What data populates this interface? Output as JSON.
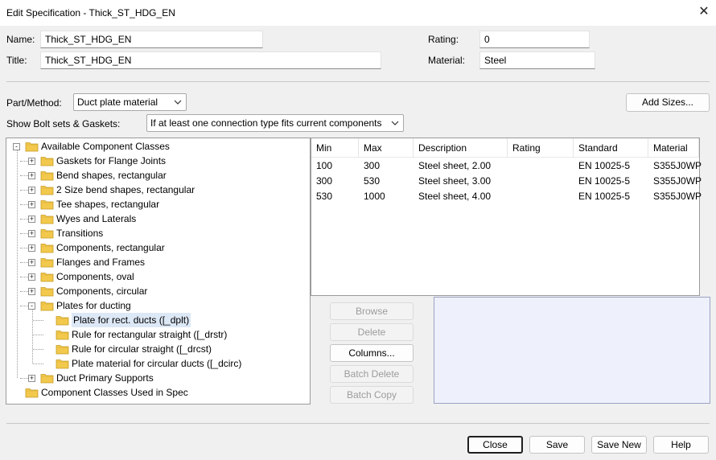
{
  "window": {
    "title": "Edit Specification - Thick_ST_HDG_EN",
    "close_glyph": "✕"
  },
  "form": {
    "name_label": "Name:",
    "name_value": "Thick_ST_HDG_EN",
    "title_label": "Title:",
    "title_value": "Thick_ST_HDG_EN",
    "rating_label": "Rating:",
    "rating_value": "0",
    "material_label": "Material:",
    "material_value": "Steel"
  },
  "part_method": {
    "label": "Part/Method:",
    "value": "Duct plate material"
  },
  "bolt_sets": {
    "label": "Show Bolt sets & Gaskets:",
    "value": "If at least one connection type fits current components"
  },
  "add_sizes_button": "Add Sizes...",
  "tree": {
    "root": "Available Component Classes",
    "items": [
      "Gaskets for Flange Joints",
      "Bend shapes, rectangular",
      "2 Size bend shapes, rectangular",
      "Tee shapes, rectangular",
      "Wyes and Laterals",
      "Transitions",
      "Components, rectangular",
      "Flanges and Frames",
      "Components, oval",
      "Components, circular",
      "Plates for ducting"
    ],
    "children": [
      "Plate for rect. ducts ([_dplt)",
      "Rule for rectangular straight ([_drstr)",
      "Rule for circular straight ([_drcst)",
      "Plate material for circular ducts ([_dcirc)"
    ],
    "after_item": "Duct Primary Supports",
    "root2": "Component Classes Used in Spec"
  },
  "table": {
    "columns": [
      "Min",
      "Max",
      "Description",
      "Rating",
      "Standard",
      "Material"
    ],
    "rows": [
      [
        "100",
        "300",
        "Steel sheet, 2.00",
        "",
        "EN 10025-5",
        "S355J0WP"
      ],
      [
        "300",
        "530",
        "Steel sheet, 3.00",
        "",
        "EN 10025-5",
        "S355J0WP"
      ],
      [
        "530",
        "1000",
        "Steel sheet, 4.00",
        "",
        "EN 10025-5",
        "S355J0WP"
      ]
    ]
  },
  "side_buttons": {
    "browse": "Browse",
    "delete": "Delete",
    "columns": "Columns...",
    "batch_delete": "Batch Delete",
    "batch_copy": "Batch Copy"
  },
  "footer": {
    "close": "Close",
    "save": "Save",
    "save_new": "Save New",
    "help": "Help"
  },
  "colors": {
    "folder": "#f2c94c",
    "selection": "#dde8f6",
    "preview": "#eef0fb"
  }
}
